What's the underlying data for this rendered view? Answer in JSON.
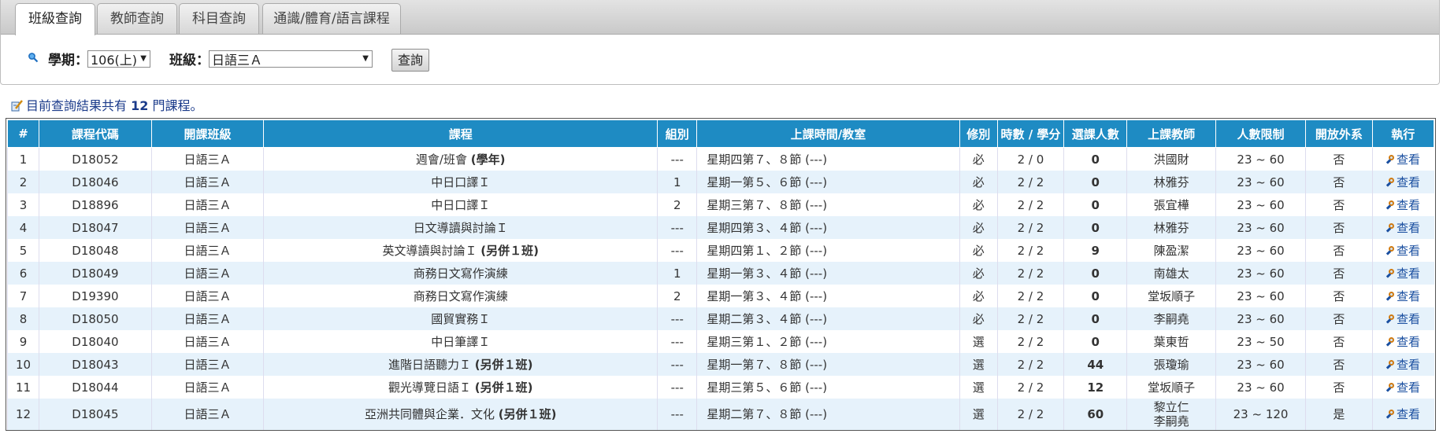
{
  "tabs": [
    {
      "label": "班級查詢",
      "active": true
    },
    {
      "label": "教師查詢",
      "active": false
    },
    {
      "label": "科目查詢",
      "active": false
    },
    {
      "label": "通識/體育/語言課程",
      "active": false
    }
  ],
  "search": {
    "term_label": "學期：",
    "term_value": "106(上)",
    "class_label": "班級：",
    "class_value": "日語三Ａ",
    "query_button": "查詢"
  },
  "result": {
    "prefix": "目前查詢結果共有 ",
    "count": "12",
    "suffix": " 門課程。"
  },
  "columns": [
    "#",
    "課程代碼",
    "開課班級",
    "課程",
    "組別",
    "上課時間/教室",
    "修別",
    "時數 / 學分",
    "選課人數",
    "上課教師",
    "人數限制",
    "開放外系",
    "執行"
  ],
  "view_label": "查看",
  "rows": [
    {
      "no": "1",
      "code": "D18052",
      "class": "日語三Ａ",
      "course": "週會/班會 ",
      "note": "(學年)",
      "group": "---",
      "time": "星期四第７、８節 (---)",
      "type": "必",
      "hours": "2 / 0",
      "enrolled": "0",
      "teacher": "洪國財",
      "teacher2": "",
      "limit": "23 ~ 60",
      "open": "否"
    },
    {
      "no": "2",
      "code": "D18046",
      "class": "日語三Ａ",
      "course": "中日口譯Ｉ",
      "note": "",
      "group": "1",
      "time": "星期一第５、６節 (---)",
      "type": "必",
      "hours": "2 / 2",
      "enrolled": "0",
      "teacher": "林雅芬",
      "teacher2": "",
      "limit": "23 ~ 60",
      "open": "否"
    },
    {
      "no": "3",
      "code": "D18896",
      "class": "日語三Ａ",
      "course": "中日口譯Ｉ",
      "note": "",
      "group": "2",
      "time": "星期三第７、８節 (---)",
      "type": "必",
      "hours": "2 / 2",
      "enrolled": "0",
      "teacher": "張宜樺",
      "teacher2": "",
      "limit": "23 ~ 60",
      "open": "否"
    },
    {
      "no": "4",
      "code": "D18047",
      "class": "日語三Ａ",
      "course": "日文導讀與討論Ｉ",
      "note": "",
      "group": "---",
      "time": "星期四第３、４節 (---)",
      "type": "必",
      "hours": "2 / 2",
      "enrolled": "0",
      "teacher": "林雅芬",
      "teacher2": "",
      "limit": "23 ~ 60",
      "open": "否"
    },
    {
      "no": "5",
      "code": "D18048",
      "class": "日語三Ａ",
      "course": "英文導讀與討論Ｉ ",
      "note": "(另併１班)",
      "group": "---",
      "time": "星期四第１、２節 (---)",
      "type": "必",
      "hours": "2 / 2",
      "enrolled": "9",
      "teacher": "陳盈潔",
      "teacher2": "",
      "limit": "23 ~ 60",
      "open": "否"
    },
    {
      "no": "6",
      "code": "D18049",
      "class": "日語三Ａ",
      "course": "商務日文寫作演練",
      "note": "",
      "group": "1",
      "time": "星期一第３、４節 (---)",
      "type": "必",
      "hours": "2 / 2",
      "enrolled": "0",
      "teacher": "南雄太",
      "teacher2": "",
      "limit": "23 ~ 60",
      "open": "否"
    },
    {
      "no": "7",
      "code": "D19390",
      "class": "日語三Ａ",
      "course": "商務日文寫作演練",
      "note": "",
      "group": "2",
      "time": "星期一第３、４節 (---)",
      "type": "必",
      "hours": "2 / 2",
      "enrolled": "0",
      "teacher": "堂坂順子",
      "teacher2": "",
      "limit": "23 ~ 60",
      "open": "否"
    },
    {
      "no": "8",
      "code": "D18050",
      "class": "日語三Ａ",
      "course": "國貿實務Ｉ",
      "note": "",
      "group": "---",
      "time": "星期二第３、４節 (---)",
      "type": "必",
      "hours": "2 / 2",
      "enrolled": "0",
      "teacher": "李嗣堯",
      "teacher2": "",
      "limit": "23 ~ 60",
      "open": "否"
    },
    {
      "no": "9",
      "code": "D18040",
      "class": "日語三Ａ",
      "course": "中日筆譯Ｉ",
      "note": "",
      "group": "---",
      "time": "星期三第１、２節 (---)",
      "type": "選",
      "hours": "2 / 2",
      "enrolled": "0",
      "teacher": "葉東哲",
      "teacher2": "",
      "limit": "23 ~ 50",
      "open": "否"
    },
    {
      "no": "10",
      "code": "D18043",
      "class": "日語三Ａ",
      "course": "進階日語聽力Ｉ ",
      "note": "(另併１班)",
      "group": "---",
      "time": "星期一第７、８節 (---)",
      "type": "選",
      "hours": "2 / 2",
      "enrolled": "44",
      "teacher": "張瓊瑜",
      "teacher2": "",
      "limit": "23 ~ 60",
      "open": "否"
    },
    {
      "no": "11",
      "code": "D18044",
      "class": "日語三Ａ",
      "course": "觀光導覽日語Ｉ ",
      "note": "(另併１班)",
      "group": "---",
      "time": "星期三第５、６節 (---)",
      "type": "選",
      "hours": "2 / 2",
      "enrolled": "12",
      "teacher": "堂坂順子",
      "teacher2": "",
      "limit": "23 ~ 60",
      "open": "否"
    },
    {
      "no": "12",
      "code": "D18045",
      "class": "日語三Ａ",
      "course": "亞洲共同體與企業．文化 ",
      "note": "(另併１班)",
      "group": "---",
      "time": "星期二第７、８節 (---)",
      "type": "選",
      "hours": "2 / 2",
      "enrolled": "60",
      "teacher": "黎立仁",
      "teacher2": "李嗣堯",
      "limit": "23 ~ 120",
      "open": "是"
    }
  ]
}
